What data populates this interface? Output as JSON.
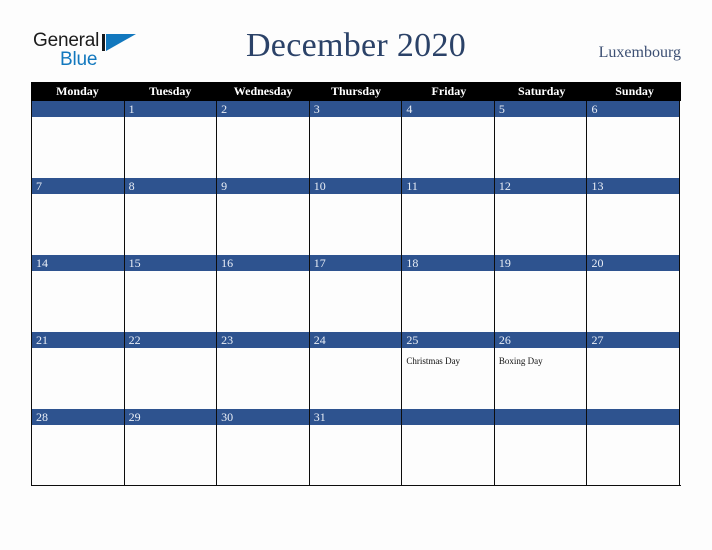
{
  "brand": {
    "word_one": "General",
    "word_two": "Blue",
    "mark": "triangle-logo"
  },
  "header": {
    "title": "December 2020",
    "country": "Luxembourg"
  },
  "colors": {
    "header_bar": "#000000",
    "day_banner": "#2e538f",
    "title_text": "#2b4268",
    "country_text": "#3c4f73",
    "brand_blue": "#1278be",
    "page_background": "#fdfdfd",
    "grid_line": "#0d0d0d"
  },
  "calendar": {
    "weekdays": [
      "Monday",
      "Tuesday",
      "Wednesday",
      "Thursday",
      "Friday",
      "Saturday",
      "Sunday"
    ],
    "weeks": [
      [
        {
          "date": "",
          "event": ""
        },
        {
          "date": "1",
          "event": ""
        },
        {
          "date": "2",
          "event": ""
        },
        {
          "date": "3",
          "event": ""
        },
        {
          "date": "4",
          "event": ""
        },
        {
          "date": "5",
          "event": ""
        },
        {
          "date": "6",
          "event": ""
        }
      ],
      [
        {
          "date": "7",
          "event": ""
        },
        {
          "date": "8",
          "event": ""
        },
        {
          "date": "9",
          "event": ""
        },
        {
          "date": "10",
          "event": ""
        },
        {
          "date": "11",
          "event": ""
        },
        {
          "date": "12",
          "event": ""
        },
        {
          "date": "13",
          "event": ""
        }
      ],
      [
        {
          "date": "14",
          "event": ""
        },
        {
          "date": "15",
          "event": ""
        },
        {
          "date": "16",
          "event": ""
        },
        {
          "date": "17",
          "event": ""
        },
        {
          "date": "18",
          "event": ""
        },
        {
          "date": "19",
          "event": ""
        },
        {
          "date": "20",
          "event": ""
        }
      ],
      [
        {
          "date": "21",
          "event": ""
        },
        {
          "date": "22",
          "event": ""
        },
        {
          "date": "23",
          "event": ""
        },
        {
          "date": "24",
          "event": ""
        },
        {
          "date": "25",
          "event": "Christmas Day"
        },
        {
          "date": "26",
          "event": "Boxing Day"
        },
        {
          "date": "27",
          "event": ""
        }
      ],
      [
        {
          "date": "28",
          "event": ""
        },
        {
          "date": "29",
          "event": ""
        },
        {
          "date": "30",
          "event": ""
        },
        {
          "date": "31",
          "event": ""
        },
        {
          "date": "",
          "event": ""
        },
        {
          "date": "",
          "event": ""
        },
        {
          "date": "",
          "event": ""
        }
      ]
    ]
  }
}
